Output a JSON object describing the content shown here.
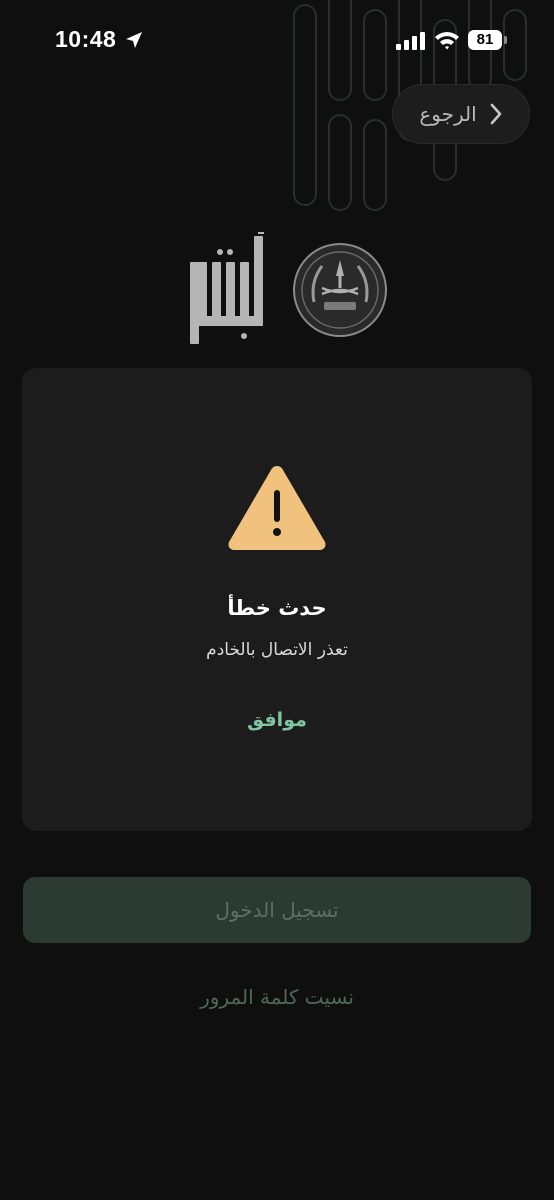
{
  "status_bar": {
    "time": "10:48",
    "battery": "81"
  },
  "header": {
    "back_label": "الرجوع"
  },
  "dialog": {
    "title": "حدث خطأ",
    "message": "تعذر الاتصال بالخادم",
    "ok_label": "موافق"
  },
  "login": {
    "login_label": "تسجيل الدخول",
    "forgot_password_label": "نسيت كلمة المرور"
  },
  "icons": {
    "location": "location-arrow-icon",
    "signal": "cellular-signal-icon",
    "wifi": "wifi-icon",
    "back": "chevron-right-icon",
    "warning": "warning-triangle-icon"
  },
  "colors": {
    "background": "#0f0f0f",
    "dialog": "#1c1c1c",
    "warning": "#f1c27d",
    "ok_text": "#7fc6a0",
    "login_button": "#2b3a33",
    "forgot_text": "#50675a"
  }
}
